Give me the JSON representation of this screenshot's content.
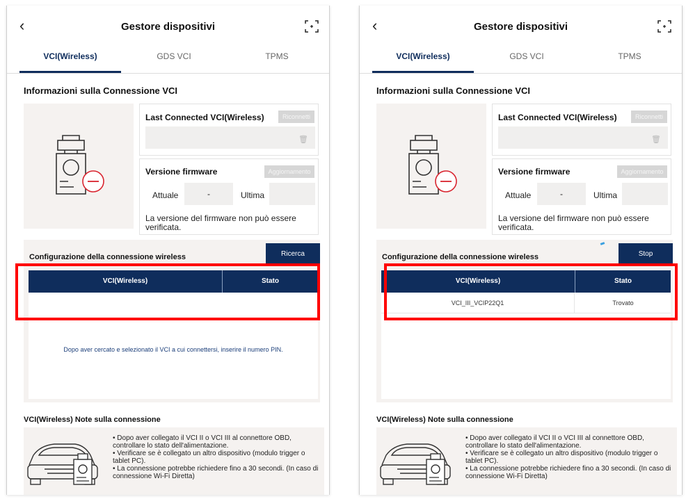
{
  "header": {
    "title": "Gestore dispositivi"
  },
  "tabs": [
    "VCI(Wireless)",
    "GDS VCI",
    "TPMS"
  ],
  "section_title": "Informazioni sulla Connessione VCI",
  "last_connected": {
    "label": "Last Connected VCI(Wireless)",
    "reconnect_label": "Riconnetti"
  },
  "firmware": {
    "label": "Versione firmware",
    "update_label": "Aggiornamento",
    "current_label": "Attuale",
    "current_value": "-",
    "latest_label": "Ultima",
    "note": "La versione del firmware non può essere verificata."
  },
  "config": {
    "title": "Configurazione della connessione wireless",
    "col_vci": "VCI(Wireless)",
    "col_status": "Stato"
  },
  "left": {
    "search_label": "Ricerca",
    "empty_message": "Dopo aver cercato e selezionato il VCI a cui connettersi, inserire il numero PIN."
  },
  "right": {
    "stop_label": "Stop",
    "rows": [
      {
        "vci": "VCI_III_VCIP22Q1",
        "status": "Trovato"
      }
    ]
  },
  "notes": {
    "title": "VCI(Wireless) Note sulla connessione",
    "items": [
      "• Dopo aver collegato il VCI II o VCI III al connettore OBD, controllare lo stato dell'alimentazione.",
      "• Verificare se è collegato un altro dispositivo (modulo trigger o tablet PC).",
      "• La connessione potrebbe richiedere fino a 30 secondi. (In caso di connessione Wi-Fi Diretta)"
    ]
  },
  "colors": {
    "navy": "#0f2d5c",
    "highlight": "#ff0000",
    "panel_grey": "#f5f2f0",
    "disabled": "#d6d6d6",
    "error": "#d9232e"
  },
  "icons": [
    "back-arrow-icon",
    "fullscreen-icon",
    "vci-disconnected-icon",
    "trash-icon",
    "car-obd-icon"
  ]
}
